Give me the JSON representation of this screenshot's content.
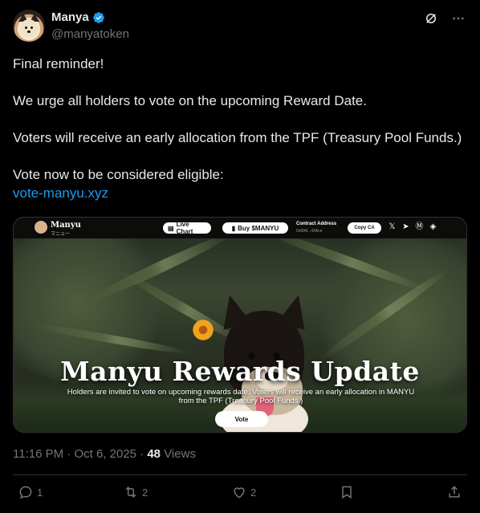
{
  "author": {
    "display_name": "Manya",
    "handle": "@manyatoken",
    "verified_icon": "verified-badge-icon"
  },
  "post": {
    "paragraphs": [
      "Final reminder!",
      "We urge all holders to vote on the upcoming Reward Date.",
      "Voters will receive an early allocation from the TPF (Treasury Pool Funds.)",
      "Vote now to be considered eligible:"
    ],
    "link": "vote-manyu.xyz"
  },
  "media": {
    "nav": {
      "brand": "Manyu",
      "brand_sub": "マニュー",
      "live_chart": "Live Chart",
      "buy": "Buy $MANYU",
      "contract_label": "Contract Address",
      "contract_value": "0x6fAf...43Ace",
      "copy_ca": "Copy CA"
    },
    "hero_title": "Manyu Rewards Update",
    "hero_desc": "Holders are invited to vote on upcoming rewards date. Voters will receive an early allocation in MANYU from the TPF (Treasury Pool Funds.)",
    "vote_button": "Vote"
  },
  "meta": {
    "time": "11:16 PM",
    "date": "Oct 6, 2025",
    "views_count": "48",
    "views_label": "Views"
  },
  "actions": {
    "replies": "1",
    "reposts": "2",
    "likes": "2"
  },
  "colors": {
    "background": "#000000",
    "text": "#e7e9ea",
    "secondary": "#71767b",
    "link": "#1d9bf0",
    "border": "#2f3336"
  }
}
